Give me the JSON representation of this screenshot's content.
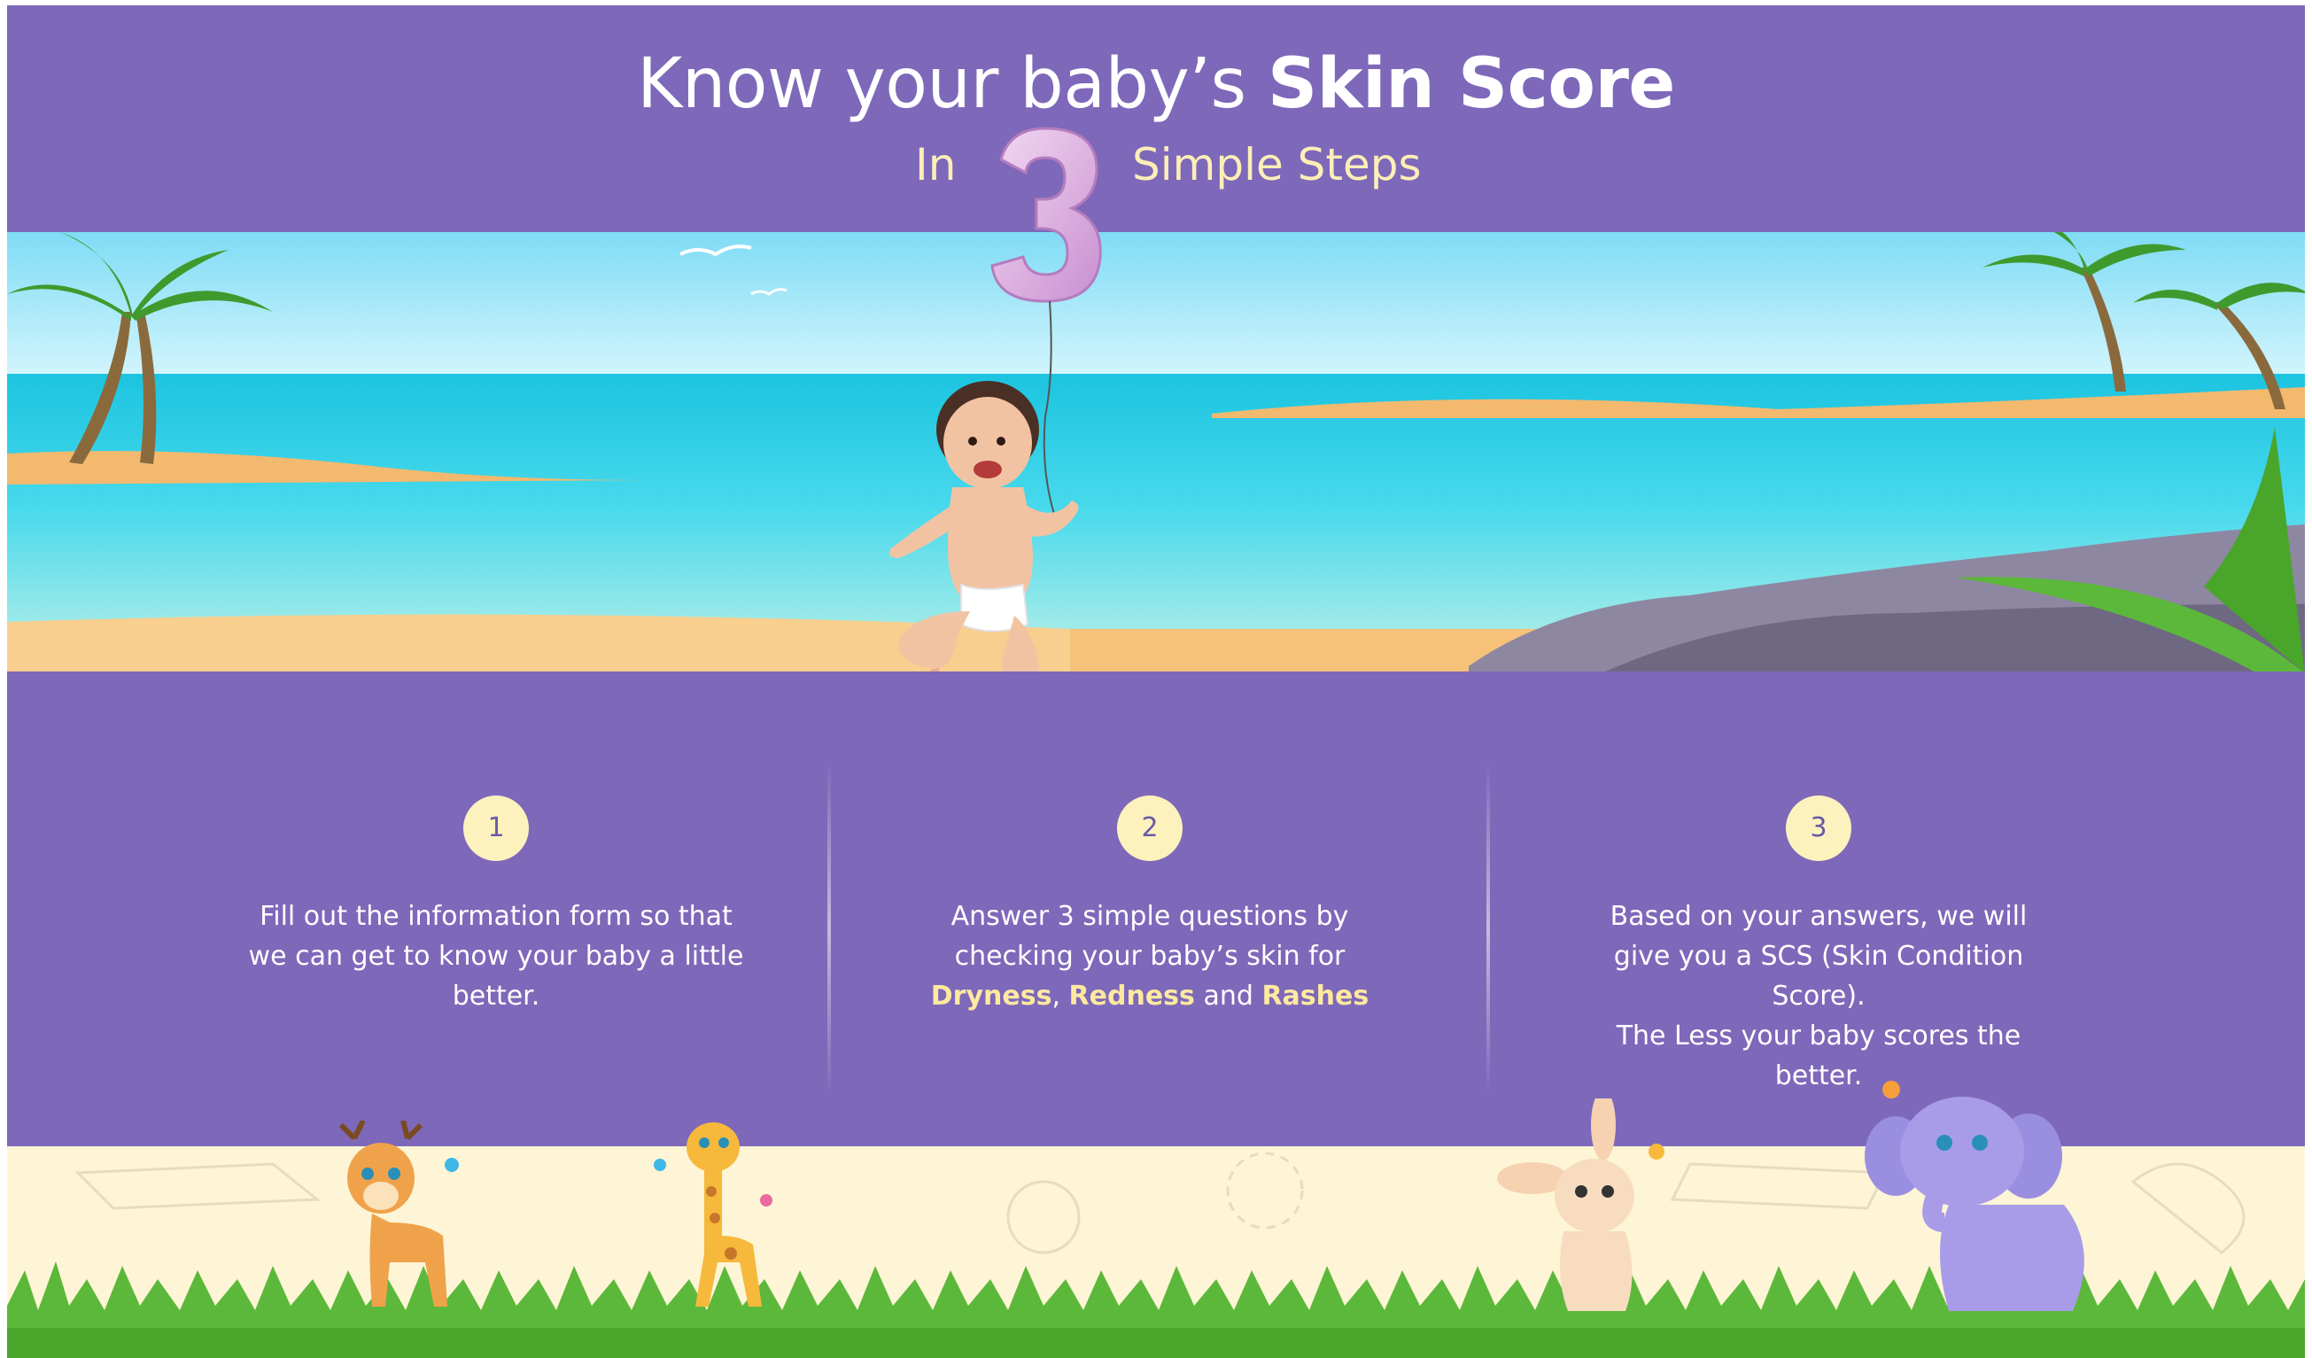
{
  "header": {
    "title_regular": "Know your baby’s",
    "title_bold": "Skin Score",
    "subtitle_prefix": "In",
    "subtitle_number": "3",
    "subtitle_suffix": "Simple Steps"
  },
  "steps": [
    {
      "number": "1",
      "text": "Fill out the information form so that we can get to know your baby a little better."
    },
    {
      "number": "2",
      "text_before": "Answer 3 simple questions by checking your baby’s skin for",
      "word1": "Dryness",
      "comma": ",",
      "word2": "Redness",
      "and": "and",
      "word3": "Rashes"
    },
    {
      "number": "3",
      "line1": "Based on your answers, we will give you a SCS (Skin Condition Score).",
      "line2": "The Less your baby scores the better."
    }
  ],
  "colors": {
    "purple": "#7e68b9",
    "cream": "#fdf2bd",
    "highlight": "#fde9a0",
    "sea": "#3fd3e8",
    "sand": "#f6c27a"
  },
  "icons": [
    "palm-tree-icon",
    "seagull-icon",
    "balloon-number-3-icon",
    "baby-illustration",
    "deer-icon",
    "giraffe-icon",
    "bunny-icon",
    "elephant-icon",
    "butterfly-icon",
    "grass-icon"
  ]
}
